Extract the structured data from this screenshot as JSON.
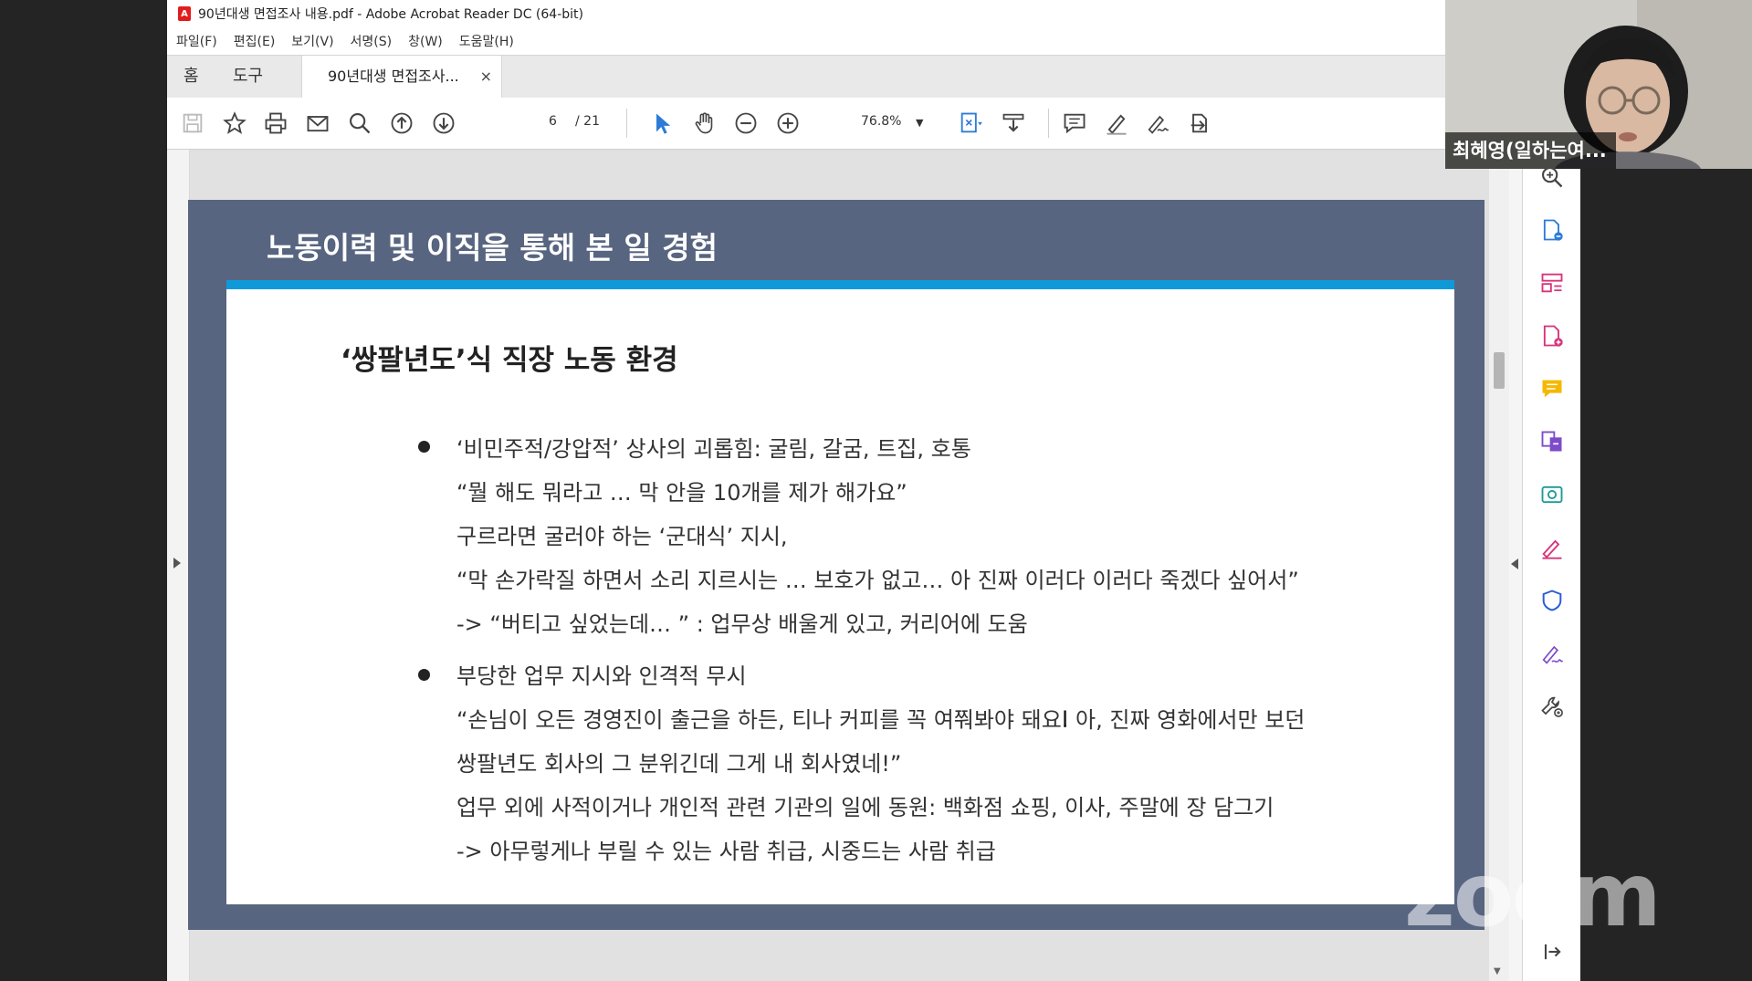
{
  "window": {
    "title": "90년대생 면접조사 내용.pdf - Adobe Acrobat Reader DC (64-bit)"
  },
  "menu": [
    "파일(F)",
    "편집(E)",
    "보기(V)",
    "서명(S)",
    "창(W)",
    "도움말(H)"
  ],
  "tabs": {
    "home": "홈",
    "tools": "도구",
    "document": "90년대생 면접조사...",
    "close": "×"
  },
  "toolbar": {
    "page_current": "6",
    "page_total": "/ 21",
    "zoom": "76.8%",
    "icons": [
      "save-icon",
      "star-icon",
      "print-icon",
      "mail-icon",
      "search-icon",
      "page-up-icon",
      "page-down-icon",
      "select-pointer-icon",
      "hand-icon",
      "zoom-out-icon",
      "zoom-in-icon",
      "fit-page-icon",
      "scroll-mode-icon",
      "comment-icon",
      "highlight-pen-icon",
      "sign-icon",
      "share-icon"
    ]
  },
  "slide": {
    "title": "노동이력 및 이직을 통해 본 일 경험",
    "heading": "‘쌍팔년도’식 직장 노동 환경",
    "bullet1": [
      "‘비민주적/강압적’ 상사의 괴롭힘: 굴림, 갈굼, 트집, 호통",
      "“뭘 해도 뭐라고 … 막 안을 10개를 제가 해가요”",
      "구르라면 굴러야 하는 ‘군대식’ 지시,",
      " “막 손가락질 하면서 소리 지르시는 … 보호가 없고… 아 진짜 이러다 이러다 죽겠다 싶어서”",
      "-> “버티고 싶었는데… ” : 업무상 배울게 있고, 커리어에 도움"
    ],
    "bullet2": [
      "부당한 업무 지시와 인격적 무시",
      "“손님이 오든 경영진이 출근을 하든, 티나 커피를 꼭 여쭤봐야 돼요. 아, 진짜 영화에서만 보던",
      "쌍팔년도 회사의 그 분위긴데 그게 내 회사였네!”",
      " 업무 외에 사적이거나 개인적 관련 기관의 일에 동원: 백화점 쇼핑, 이사, 주말에 장 담그기",
      "-> 아무렇게나 부릴 수 있는 사람 취급, 시중드는 사람 취급"
    ]
  },
  "right_pane_icons": [
    "zoom-tool-icon",
    "export-pdf-icon",
    "organize-pages-icon",
    "create-pdf-icon",
    "comment-tool-icon",
    "combine-files-icon",
    "send-review-icon",
    "fill-sign-icon",
    "protect-icon",
    "signature-icon",
    "more-tools-icon",
    "collapse-pane-icon"
  ],
  "zoom_overlay": {
    "participant_name": "최혜영(일하는여...",
    "logo": "zoom"
  },
  "colors": {
    "slide_background": "#586580",
    "accent_bar": "#0e9ad9",
    "acrobat_red": "#e21c1c",
    "tool_blue": "#2d7bd6",
    "tool_pink": "#d6347a",
    "tool_purple": "#7d4bc9"
  }
}
